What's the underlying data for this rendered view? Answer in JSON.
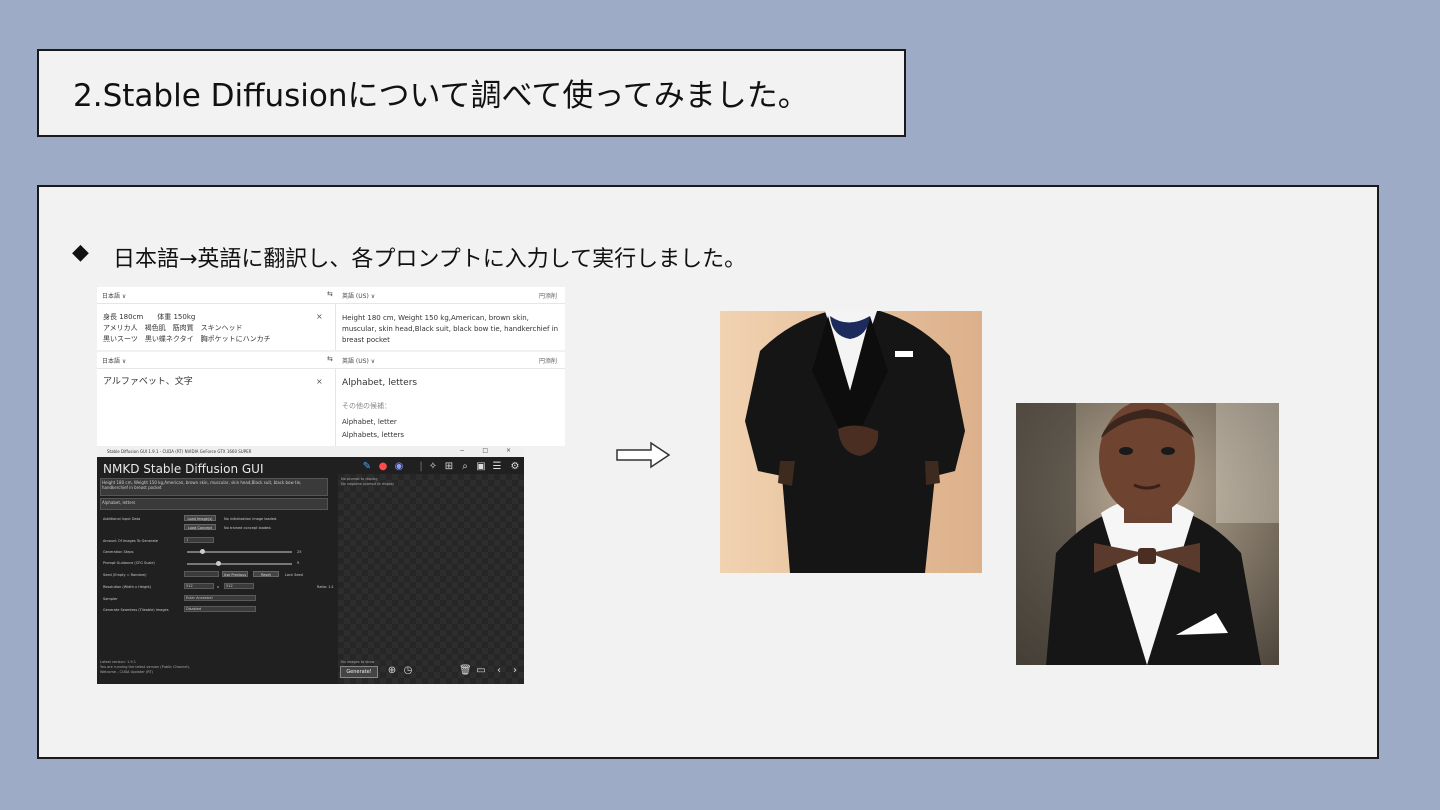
{
  "slide": {
    "title": "2.Stable Diffusionについて調べて使ってみました。",
    "bullet_symbol": "◆",
    "bullet_text": "日本語→英語に翻訳し、各プロンプトに入力して実行しました。"
  },
  "translate1": {
    "source_lang": "日本語 ∨",
    "swap_icon": "swap-arrows",
    "target_lang": "英語 (US) ∨",
    "corner": "円添削",
    "source_text": "身長 180cm　　体重 150kg\nアメリカ人　褐色肌　筋肉質　スキンヘッド\n黒いスーツ　黒い蝶ネクタイ　胸ポケットにハンカチ",
    "clear": "×",
    "translated_text": "Height 180 cm, Weight 150 kg,American, brown skin, muscular, skin head,Black suit, black bow tie, handkerchief in breast pocket"
  },
  "translate2": {
    "source_lang": "日本語 ∨",
    "target_lang": "英語 (US) ∨",
    "corner": "円添削",
    "source_text": "アルファベット、文字",
    "clear": "×",
    "translated_text": "Alphabet, letters",
    "alt_heading": "その他の候補：",
    "alternatives": [
      "Alphabet, letter",
      "Alphabets, letters"
    ]
  },
  "nmkd": {
    "window_title": "Stable Diffusion GUI 1.9.1 - CUDA (RT) NVIDIA GeForce GTX 1660 SUPER",
    "window_controls": "− □ ×",
    "app_title": "NMKD Stable Diffusion GUI",
    "prompt": "Height 180 cm, Weight 150 kg,American, brown skin, muscular, skin head,Black suit, black bow tie, handkerchief in breast pocket",
    "negative_prompt": "Alphabet, letters",
    "preview_note1": "No prompt to display",
    "preview_note2": "No negative prompt to display",
    "labels": {
      "additional_data": "Additional Input Data",
      "load_image": "Load Image(s)",
      "no_image": "No initialization image loaded.",
      "load_concept": "Load Concept",
      "no_concept": "No trained concept loaded.",
      "amount": "Amount Of Images To Generate",
      "steps": "Generation Steps",
      "guidance": "Prompt Guidance (CFG Scale)",
      "seed": "Seed (Empty = Random)",
      "use_previous": "Use Previous",
      "reset": "Reset",
      "lock_seed": "Lock Seed",
      "resolution": "Resolution (Width x Height)",
      "sampler": "Sampler",
      "nsfw": "Generate Seamless (Tileable) Images"
    },
    "values": {
      "amount": "1",
      "steps": "25",
      "guidance": "9",
      "width": "512",
      "height": "512",
      "times": "x",
      "sampler": "Euler Ancestral",
      "seamless": "Disabled",
      "ratio": "Ratio: 1:1"
    },
    "slider_levels": {
      "steps": 0.15,
      "guidance": 0.3
    },
    "log": [
      "Latest version: 1.9.1",
      "You are running the latest version (Public Channel).",
      "Welcome - CUDA Updater (RT)"
    ],
    "preview_bottom_note": "No images to show",
    "generate_label": "Generate!"
  }
}
